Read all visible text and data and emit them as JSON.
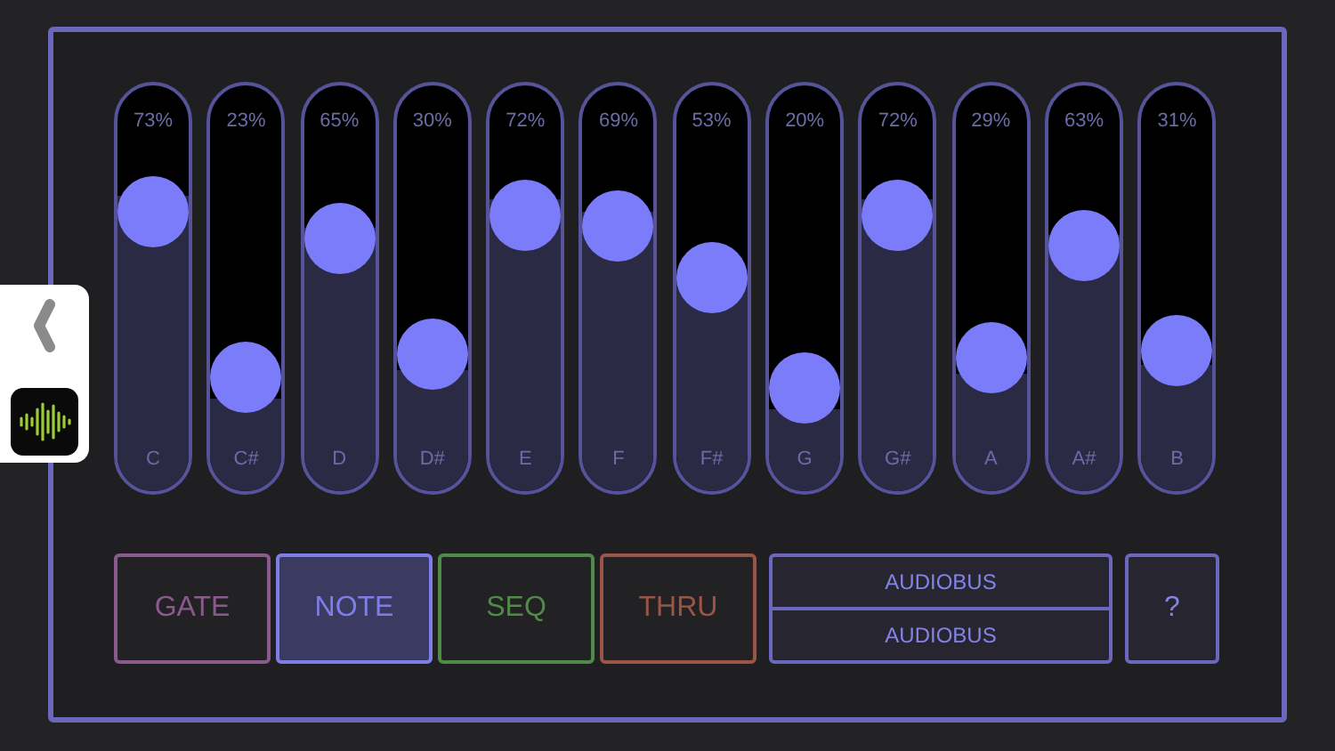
{
  "sliders": [
    {
      "note": "C",
      "reading": "73%",
      "level": 0.73
    },
    {
      "note": "C#",
      "reading": "23%",
      "level": 0.23
    },
    {
      "note": "D",
      "reading": "65%",
      "level": 0.65
    },
    {
      "note": "D#",
      "reading": "30%",
      "level": 0.3
    },
    {
      "note": "E",
      "reading": "72%",
      "level": 0.72
    },
    {
      "note": "F",
      "reading": "69%",
      "level": 0.69
    },
    {
      "note": "F#",
      "reading": "53%",
      "level": 0.53
    },
    {
      "note": "G",
      "reading": "20%",
      "level": 0.2
    },
    {
      "note": "G#",
      "reading": "72%",
      "level": 0.72
    },
    {
      "note": "A",
      "reading": "29%",
      "level": 0.29
    },
    {
      "note": "A#",
      "reading": "63%",
      "level": 0.63
    },
    {
      "note": "B",
      "reading": "31%",
      "level": 0.31
    }
  ],
  "modes": [
    {
      "label": "GATE",
      "color": "#8a5a8e",
      "selected": false
    },
    {
      "label": "NOTE",
      "color": "#7f7de8",
      "selected": true
    },
    {
      "label": "SEQ",
      "color": "#4f8a48",
      "selected": false
    },
    {
      "label": "THRU",
      "color": "#9a5548",
      "selected": false
    }
  ],
  "audiobus": [
    "AUDIOBUS",
    "AUDIOBUS"
  ],
  "help_button": "?"
}
